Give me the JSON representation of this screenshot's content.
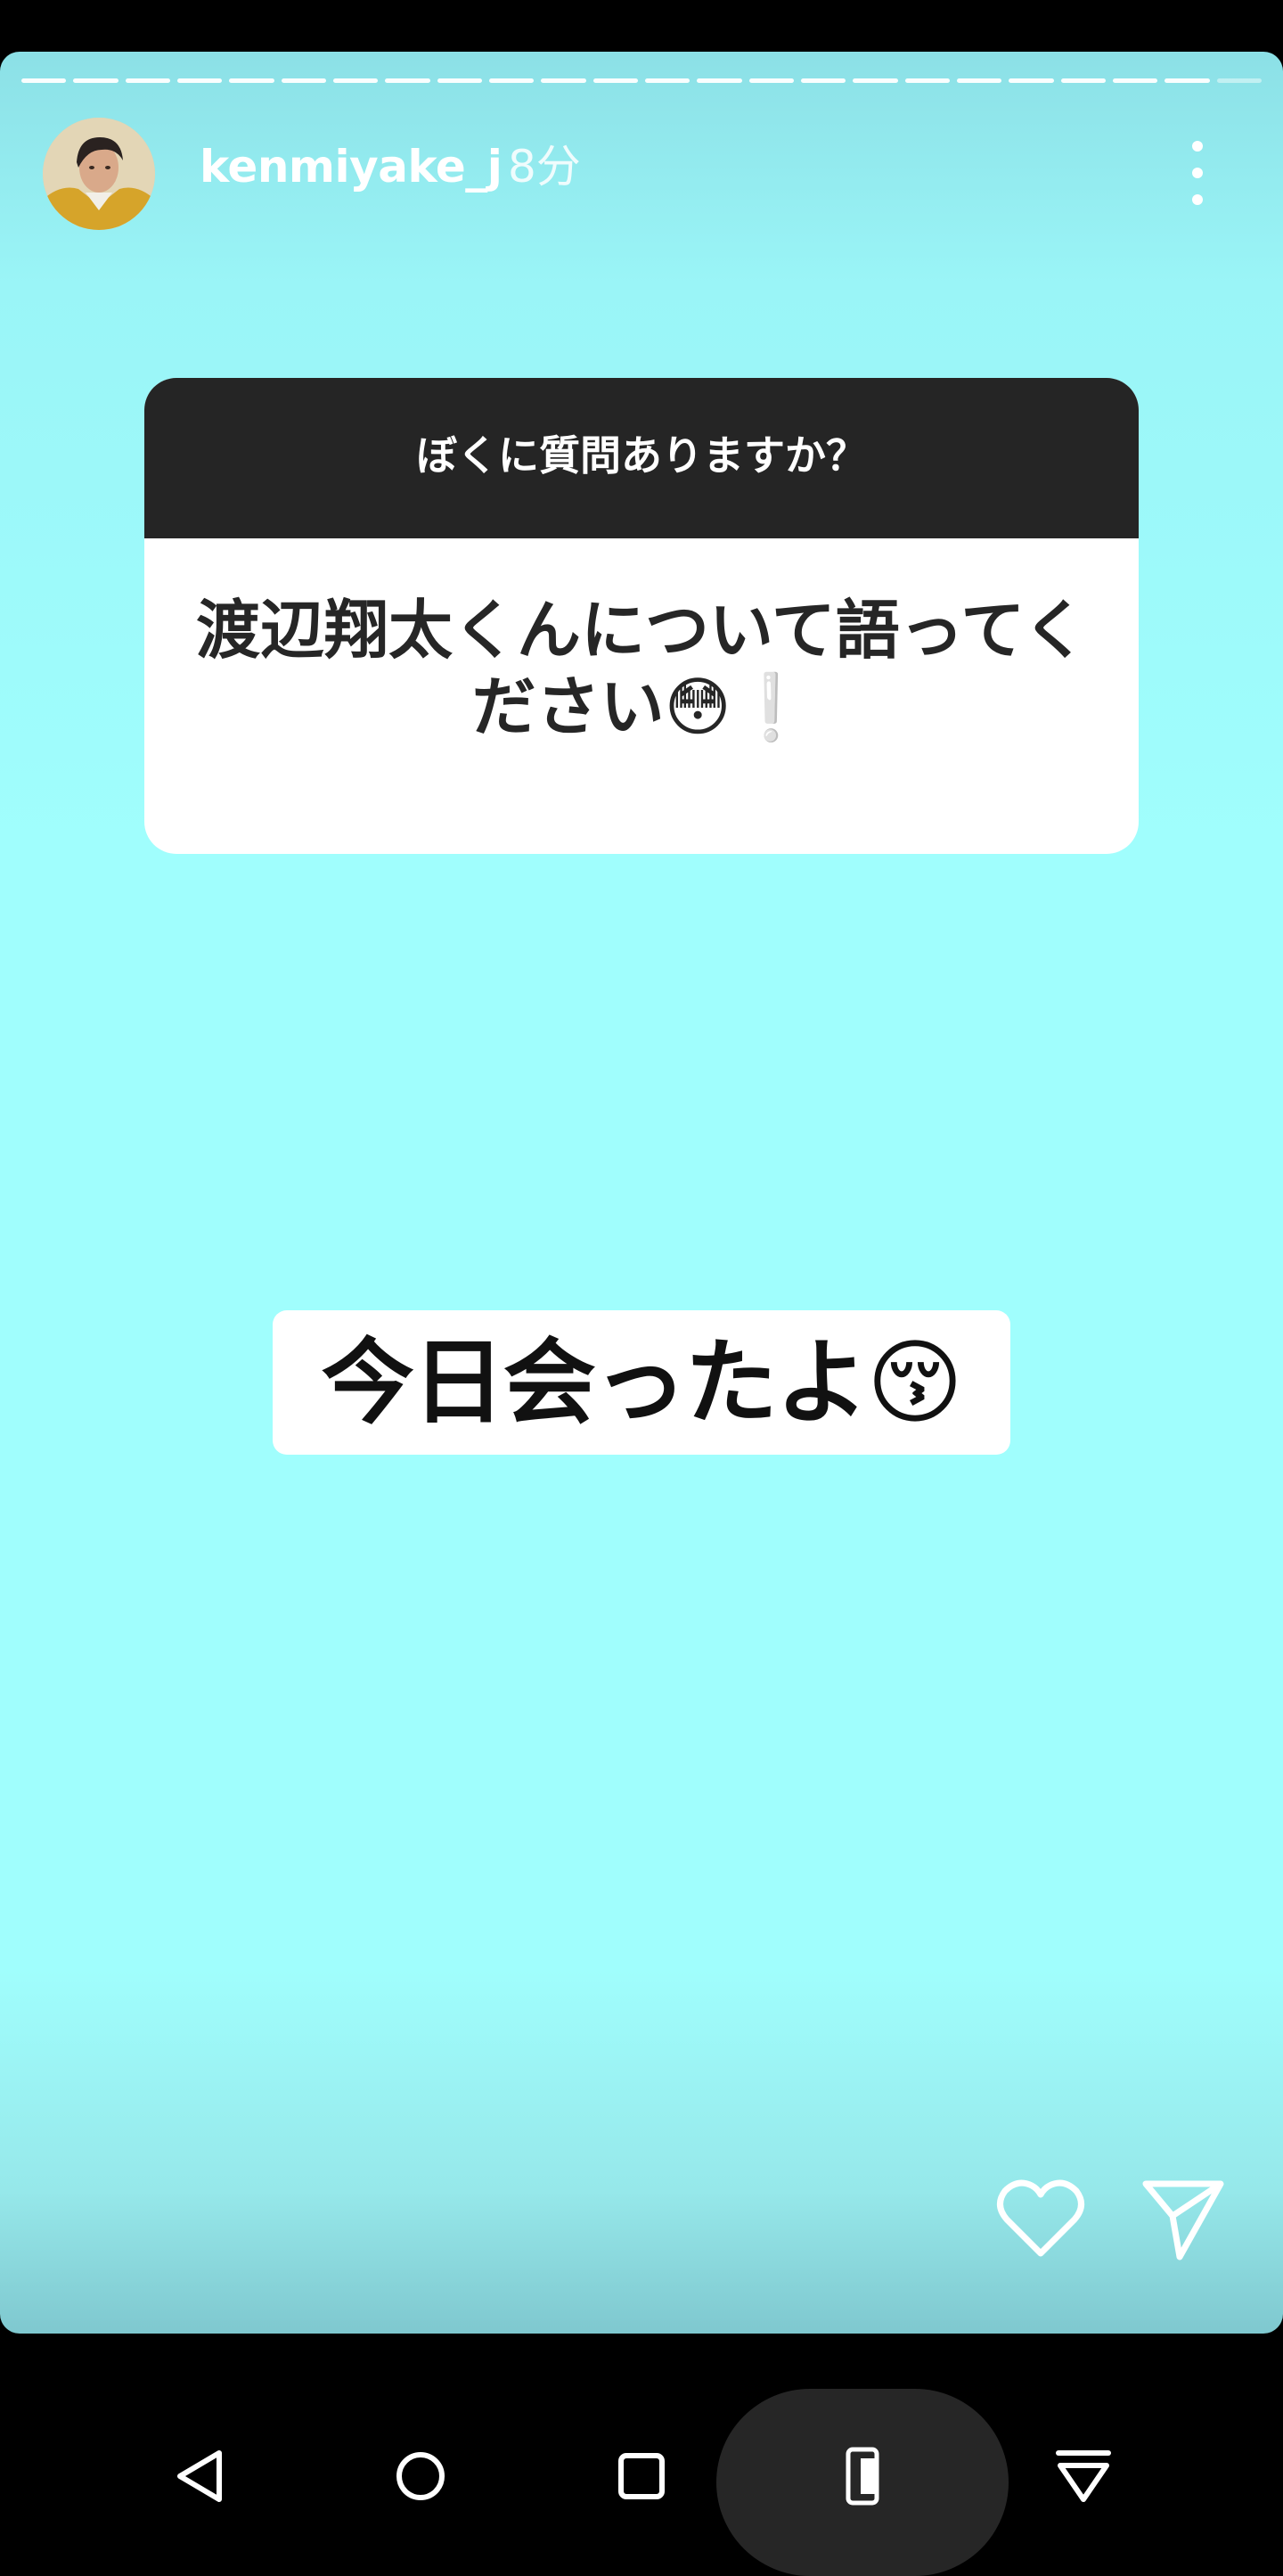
{
  "story": {
    "username": "kenmiyake_j",
    "time_ago": "8分",
    "progress_segments": 24,
    "progress_active": 23
  },
  "question": {
    "prompt": "ぼくに質問ありますか？",
    "answer_line1": "渡辺翔太くんについて語ってく",
    "answer_line2": "ださい😳❕"
  },
  "caption": {
    "text": "今日会ったよ😚"
  },
  "icons": {
    "more": "more-vertical-icon",
    "like": "heart-icon",
    "share": "send-icon"
  },
  "navbar": {
    "buttons": [
      "back-icon",
      "home-icon",
      "recents-icon",
      "rotate-icon",
      "hide-keyboard-icon"
    ]
  },
  "colors": {
    "background": "#a0fefd",
    "question_header": "#252525",
    "nav_bar": "#000000"
  }
}
